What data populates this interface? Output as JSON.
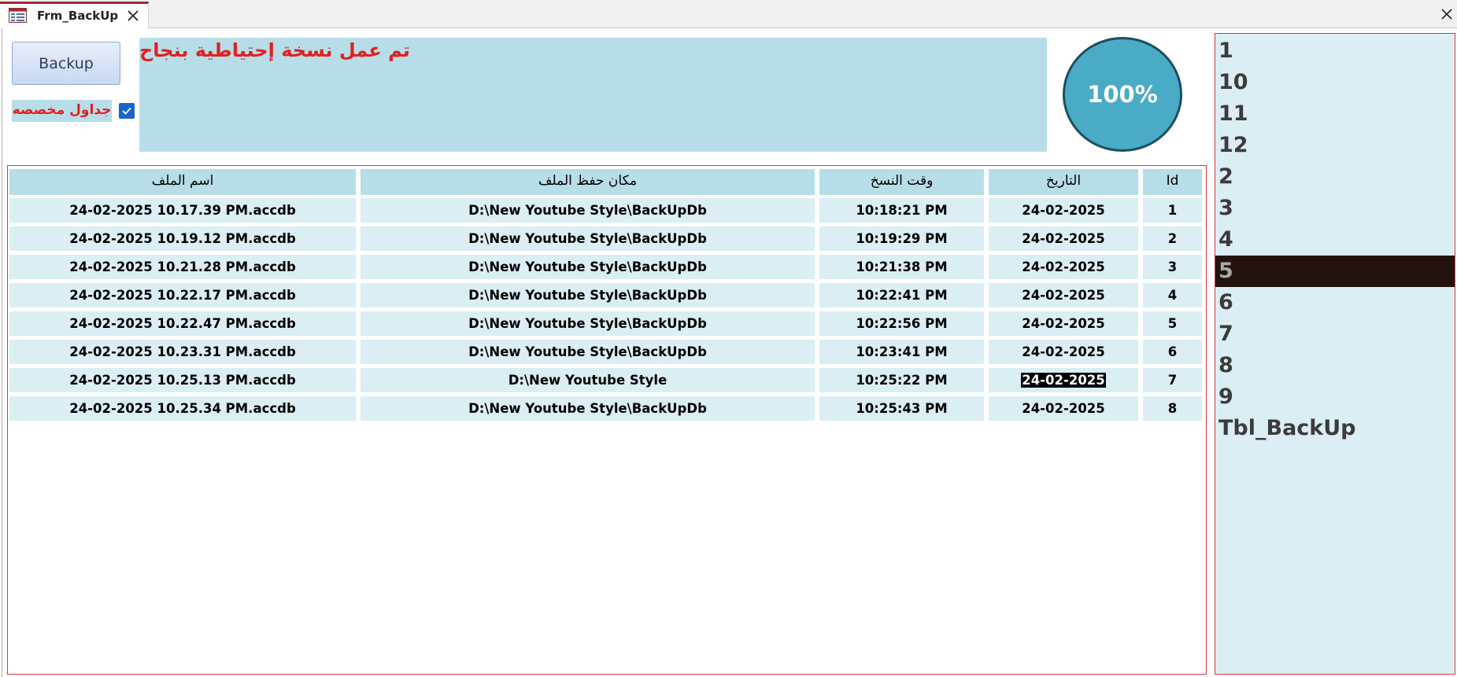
{
  "tab": {
    "title": "Frm_BackUp"
  },
  "form": {
    "backup_label": "Backup",
    "custom_tables_label": "جداول مخصصه",
    "custom_tables_checked": true,
    "status_message": "تم عمل نسخة إحتياطية بنجاح",
    "progress_text": "100%",
    "progress": 1.0
  },
  "table": {
    "headers": {
      "file_name": "اسم الملف",
      "save_location": "مكان حفظ الملف",
      "backup_time": "وقت النسخ",
      "date": "التاريخ",
      "id": "Id"
    },
    "rows": [
      {
        "file_name": "24-02-2025 10.17.39 PM.accdb",
        "save_location": "D:\\New Youtube Style\\BackUpDb",
        "backup_time": "10:18:21 PM",
        "date": "24-02-2025",
        "id": "1"
      },
      {
        "file_name": "24-02-2025 10.19.12 PM.accdb",
        "save_location": "D:\\New Youtube Style\\BackUpDb",
        "backup_time": "10:19:29 PM",
        "date": "24-02-2025",
        "id": "2"
      },
      {
        "file_name": "24-02-2025 10.21.28 PM.accdb",
        "save_location": "D:\\New Youtube Style\\BackUpDb",
        "backup_time": "10:21:38 PM",
        "date": "24-02-2025",
        "id": "3"
      },
      {
        "file_name": "24-02-2025 10.22.17 PM.accdb",
        "save_location": "D:\\New Youtube Style\\BackUpDb",
        "backup_time": "10:22:41 PM",
        "date": "24-02-2025",
        "id": "4"
      },
      {
        "file_name": "24-02-2025 10.22.47 PM.accdb",
        "save_location": "D:\\New Youtube Style\\BackUpDb",
        "backup_time": "10:22:56 PM",
        "date": "24-02-2025",
        "id": "5"
      },
      {
        "file_name": "24-02-2025 10.23.31 PM.accdb",
        "save_location": "D:\\New Youtube Style\\BackUpDb",
        "backup_time": "10:23:41 PM",
        "date": "24-02-2025",
        "id": "6"
      },
      {
        "file_name": "24-02-2025 10.25.13 PM.accdb",
        "save_location": "D:\\New Youtube Style",
        "backup_time": "10:25:22 PM",
        "date": "24-02-2025",
        "id": "7",
        "date_highlighted": true
      },
      {
        "file_name": "24-02-2025 10.25.34 PM.accdb",
        "save_location": "D:\\New Youtube Style\\BackUpDb",
        "backup_time": "10:25:43 PM",
        "date": "24-02-2025",
        "id": "8"
      }
    ]
  },
  "table_list": {
    "items": [
      "1",
      "10",
      "11",
      "12",
      "2",
      "3",
      "4",
      "5",
      "6",
      "7",
      "8",
      "9",
      "Tbl_BackUp"
    ],
    "selected": "5"
  },
  "colors": {
    "accent_red": "#e02020",
    "panel_blue": "#b7dde8",
    "row_blue": "#daeef4",
    "progress_fill": "#4aabc7",
    "selected_item": "#24130d"
  },
  "icons": {
    "form": "form-icon",
    "tab_close": "close-icon",
    "window_close": "close-icon",
    "checkbox": "checkmark-icon"
  }
}
